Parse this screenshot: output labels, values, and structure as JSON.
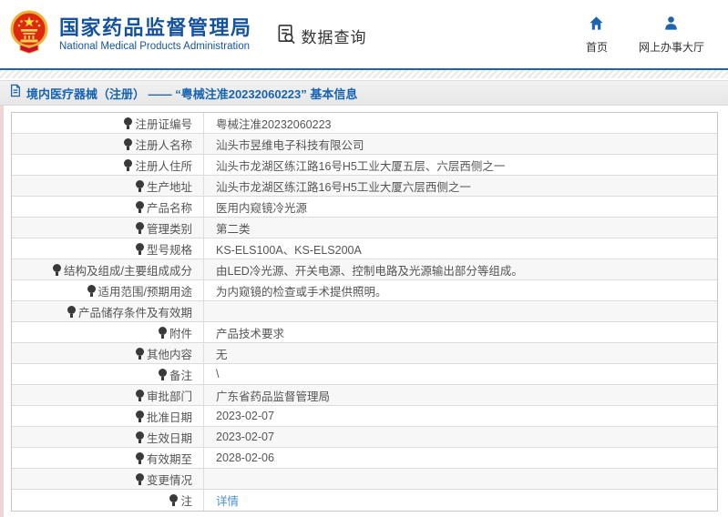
{
  "header": {
    "org_name_cn": "国家药品监督管理局",
    "org_name_en": "National Medical Products Administration",
    "section_label": "数据查询",
    "nav": [
      {
        "label": "首页",
        "icon": "home-icon"
      },
      {
        "label": "网上办事大厅",
        "icon": "user-icon"
      }
    ]
  },
  "page_title": "境内医疗器械（注册） ——  “粤械注准20232060223”  基本信息",
  "table": {
    "rows": [
      {
        "label": "注册证编号",
        "value": "粤械注准20232060223"
      },
      {
        "label": "注册人名称",
        "value": "汕头市昱维电子科技有限公司"
      },
      {
        "label": "注册人住所",
        "value": "汕头市龙湖区练江路16号H5工业大厦五层、六层西侧之一"
      },
      {
        "label": "生产地址",
        "value": "汕头市龙湖区练江路16号H5工业大厦六层西侧之一"
      },
      {
        "label": "产品名称",
        "value": "医用内窥镜冷光源"
      },
      {
        "label": "管理类别",
        "value": "第二类"
      },
      {
        "label": "型号规格",
        "value": "KS-ELS100A、KS-ELS200A"
      },
      {
        "label": "结构及组成/主要组成成分",
        "value": "由LED冷光源、开关电源、控制电路及光源输出部分等组成。"
      },
      {
        "label": "适用范围/预期用途",
        "value": "为内窥镜的检查或手术提供照明。"
      },
      {
        "label": "产品储存条件及有效期",
        "value": ""
      },
      {
        "label": "附件",
        "value": "产品技术要求"
      },
      {
        "label": "其他内容",
        "value": "无"
      },
      {
        "label": "备注",
        "value": "\\"
      },
      {
        "label": "审批部门",
        "value": "广东省药品监督管理局"
      },
      {
        "label": "批准日期",
        "value": "2023-02-07"
      },
      {
        "label": "生效日期",
        "value": "2023-02-07"
      },
      {
        "label": "有效期至",
        "value": "2028-02-06"
      },
      {
        "label": "变更情况",
        "value": ""
      },
      {
        "label": "注",
        "value": "详情",
        "link": true,
        "label_icon": "note-bulb-icon"
      }
    ]
  },
  "colors": {
    "brand_blue": "#15539e",
    "separator_blue": "#1d64b5",
    "title_blue": "#1663b5",
    "link_blue": "#4a90d2",
    "row_alt_gray": "#f7f7f7",
    "edge_strip_pink": "#f3d4d4",
    "emblem_red": "#de2910",
    "emblem_gold": "#e8b33a"
  }
}
